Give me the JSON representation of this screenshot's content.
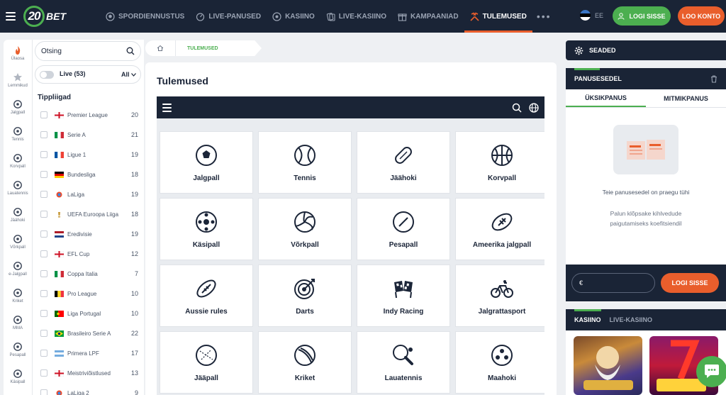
{
  "header": {
    "logo_number": "20",
    "logo_text": "BET",
    "nav": [
      {
        "label": "SPORDIENNUSTUS",
        "icon": "football-icon"
      },
      {
        "label": "LIVE-PANUSED",
        "icon": "live-icon"
      },
      {
        "label": "KASIINO",
        "icon": "casino-chip-icon"
      },
      {
        "label": "LIVE-KASIINO",
        "icon": "cards-icon"
      },
      {
        "label": "KAMPAANIAD",
        "icon": "gift-icon"
      },
      {
        "label": "TULEMUSED",
        "icon": "results-icon",
        "active": true
      }
    ],
    "more": "•••",
    "language": "EE",
    "login_label": "LOGI SISSE",
    "register_label": "LOO KONTO",
    "colors": {
      "bg": "#1a2436",
      "accent_green": "#4caf50",
      "accent_orange": "#e95e2c"
    }
  },
  "rail": [
    {
      "label": "Ülaosa",
      "icon": "flame-icon"
    },
    {
      "label": "Lemmikud",
      "icon": "star-icon"
    },
    {
      "label": "Jalgpall",
      "icon": "soccer-ball-icon"
    },
    {
      "label": "Tennis",
      "icon": "tennis-ball-icon"
    },
    {
      "label": "Korvpall",
      "icon": "basketball-icon"
    },
    {
      "label": "Lauatennis",
      "icon": "table-tennis-icon"
    },
    {
      "label": "Jäähoki",
      "icon": "hockey-icon"
    },
    {
      "label": "Võrkpall",
      "icon": "volleyball-icon"
    },
    {
      "label": "e-Jalgpall",
      "icon": "esoccer-icon"
    },
    {
      "label": "Kriket",
      "icon": "cricket-icon"
    },
    {
      "label": "MMA",
      "icon": "mma-icon"
    },
    {
      "label": "Pesapall",
      "icon": "baseball-icon"
    },
    {
      "label": "Käsipall",
      "icon": "handball-icon"
    }
  ],
  "sidebar": {
    "search_placeholder": "Otsing",
    "live_label": "Live (53)",
    "filter_label": "All",
    "section_title": "Tippliigad",
    "leagues": [
      {
        "name": "Premier League",
        "count": "20"
      },
      {
        "name": "Serie A",
        "count": "21"
      },
      {
        "name": "Ligue 1",
        "count": "19"
      },
      {
        "name": "Bundesliga",
        "count": "18"
      },
      {
        "name": "LaLiga",
        "count": "19"
      },
      {
        "name": "UEFA Euroopa Liiga",
        "count": "18"
      },
      {
        "name": "Eredivisie",
        "count": "19"
      },
      {
        "name": "EFL Cup",
        "count": "12"
      },
      {
        "name": "Coppa Italia",
        "count": "7"
      },
      {
        "name": "Pro League",
        "count": "10"
      },
      {
        "name": "Liga Portugal",
        "count": "10"
      },
      {
        "name": "Brasileiro Serie A",
        "count": "22"
      },
      {
        "name": "Primera LPF",
        "count": "17"
      },
      {
        "name": "Meistriviõistlused",
        "count": "13"
      },
      {
        "name": "LaLiga 2",
        "count": "9"
      }
    ]
  },
  "breadcrumb": {
    "current": "TULEMUSED"
  },
  "main": {
    "title": "Tulemused",
    "tiles": [
      "Jalgpall",
      "Tennis",
      "Jäähoki",
      "Korvpall",
      "Käsipall",
      "Võrkpall",
      "Pesapall",
      "Ameerika jalgpall",
      "Aussie rules",
      "Darts",
      "Indy Racing",
      "Jalgrattasport",
      "Jääpall",
      "Kriket",
      "Lauatennis",
      "Maahoki"
    ]
  },
  "right": {
    "settings_label": "SEADED",
    "betslip_title": "PANUSESEDEL",
    "tab_single": "ÜKSIKPANUS",
    "tab_multi": "MITMIKPANUS",
    "empty_text": "Teie panusesedel on praegu tühi",
    "hint_text": "Palun klõpsake kihlvedude paigutamiseks koefitsiendil",
    "stake_symbol": "€",
    "login_label": "LOGI SISSE",
    "casino_tab": "KASIINO",
    "live_casino_tab": "LIVE-KASIINO"
  }
}
